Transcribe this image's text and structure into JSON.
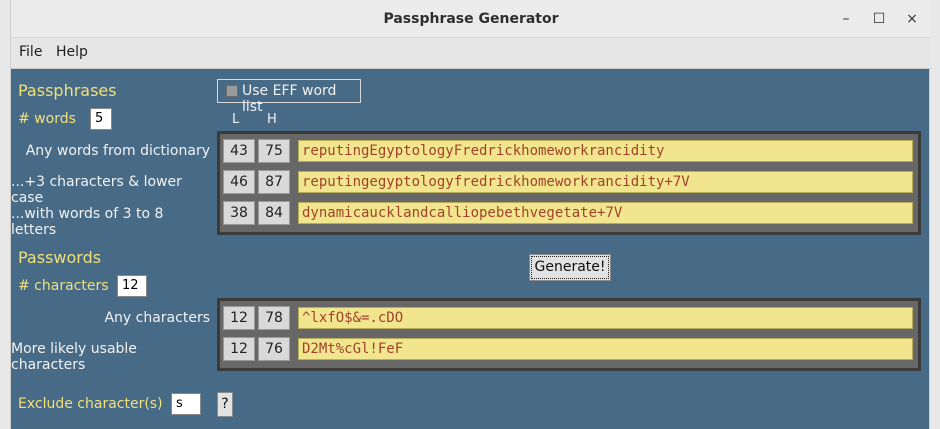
{
  "window": {
    "title": "Passphrase Generator",
    "controls": {
      "minimize": "–",
      "maximize": "☐",
      "close": "×"
    }
  },
  "menu": {
    "file": "File",
    "help": "Help"
  },
  "passphrases": {
    "heading": "Passphrases",
    "use_eff_label": "Use EFF word list",
    "use_eff_checked": false,
    "num_words_label": "# words",
    "num_words_value": "5",
    "col_l": "L",
    "col_h": "H",
    "rows": [
      {
        "label": "Any words from dictionary",
        "l": "43",
        "h": "75",
        "value": "reputingEgyptologyFredrickhomeworkrancidity"
      },
      {
        "label": "...+3 characters & lower case",
        "l": "46",
        "h": "87",
        "value": "reputingegyptologyfredrickhomeworkrancidity+7V"
      },
      {
        "label": "...with words of 3 to 8 letters",
        "l": "38",
        "h": "84",
        "value": "dynamicaucklandcalliopebethvegetate+7V"
      }
    ]
  },
  "generate_label": "Generate!",
  "passwords": {
    "heading": "Passwords",
    "num_chars_label": "# characters",
    "num_chars_value": "12",
    "rows": [
      {
        "label": "Any characters",
        "l": "12",
        "h": "78",
        "value": "^lxfO$&=.cDO"
      },
      {
        "label": "More likely usable characters",
        "l": "12",
        "h": "76",
        "value": "D2Mt%cGl!FeF"
      }
    ]
  },
  "exclude": {
    "label": "Exclude character(s)",
    "value": "s",
    "help_label": "?"
  },
  "colors": {
    "background": "#476a87",
    "accent_text": "#f0e07a",
    "entry_bg": "#f1e68e",
    "entry_text": "#a0422b"
  }
}
